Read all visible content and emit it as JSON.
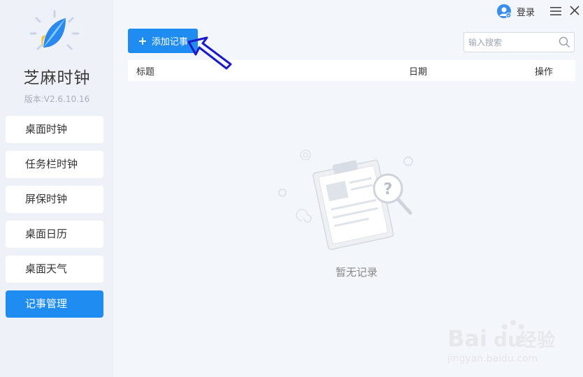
{
  "app": {
    "title": "芝麻时钟",
    "version": "版本:V2.6.10.16"
  },
  "sidebar": {
    "items": [
      {
        "label": "桌面时钟"
      },
      {
        "label": "任务栏时钟"
      },
      {
        "label": "屏保时钟"
      },
      {
        "label": "桌面日历"
      },
      {
        "label": "桌面天气"
      },
      {
        "label": "记事管理",
        "active": true
      }
    ]
  },
  "topbar": {
    "login_label": "登录"
  },
  "toolbar": {
    "add_label": "添加记事",
    "search_placeholder": "输入搜索"
  },
  "table": {
    "columns": [
      "标题",
      "日期",
      "操作"
    ]
  },
  "empty_state": {
    "text": "暂无记录"
  },
  "watermark": {
    "brand": "Bai du 经验",
    "url": "jingyan.baidu.com"
  },
  "colors": {
    "accent": "#1f8cf2",
    "sidebar_bg": "#eef2f8",
    "annotation_arrow": "#1a1acc"
  }
}
